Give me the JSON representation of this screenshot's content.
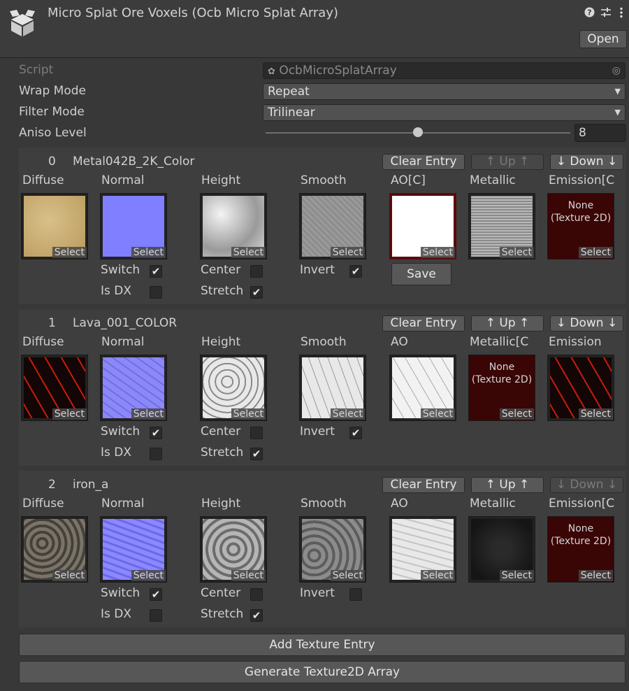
{
  "header": {
    "title": "Micro Splat Ore Voxels (Ocb Micro Splat Array)",
    "open_label": "Open",
    "help_icon": "help-icon",
    "settings_icon": "sliders-icon",
    "menu_icon": "kebab-menu-icon"
  },
  "properties": {
    "script_label": "Script",
    "script_value": "OcbMicroSplatArray",
    "wrap_label": "Wrap Mode",
    "wrap_value": "Repeat",
    "filter_label": "Filter Mode",
    "filter_value": "Trilinear",
    "aniso_label": "Aniso Level",
    "aniso_value": "8",
    "aniso_level": 8
  },
  "entries": [
    {
      "index": "0",
      "name": "Metal042B_2K_Color",
      "clear_label": "Clear Entry",
      "up_label": "↑ Up ↑",
      "down_label": "↓ Down ↓",
      "up_enabled": false,
      "down_enabled": true,
      "slots": {
        "diffuse": "Diffuse",
        "normal": "Normal",
        "height": "Height",
        "smooth": "Smooth",
        "ao": "AO[C]",
        "metallic": "Metallic",
        "emission": "Emission[C"
      },
      "select": "Select",
      "emission_none": "None\n(Texture 2D)",
      "switch_label": "Switch",
      "isdx_label": "Is DX",
      "center_label": "Center",
      "stretch_label": "Stretch",
      "invert_label": "Invert",
      "switch": true,
      "isdx": false,
      "center": false,
      "stretch": true,
      "invert": true,
      "save_label": "Save"
    },
    {
      "index": "1",
      "name": "Lava_001_COLOR",
      "clear_label": "Clear Entry",
      "up_label": "↑ Up ↑",
      "down_label": "↓ Down ↓",
      "up_enabled": true,
      "down_enabled": true,
      "slots": {
        "diffuse": "Diffuse",
        "normal": "Normal",
        "height": "Height",
        "smooth": "Smooth",
        "ao": "AO",
        "metallic": "Metallic[C",
        "emission": "Emission"
      },
      "select": "Select",
      "metallic_none": "None\n(Texture 2D)",
      "switch_label": "Switch",
      "isdx_label": "Is DX",
      "center_label": "Center",
      "stretch_label": "Stretch",
      "invert_label": "Invert",
      "switch": true,
      "isdx": false,
      "center": false,
      "stretch": true,
      "invert": true
    },
    {
      "index": "2",
      "name": "iron_a",
      "clear_label": "Clear Entry",
      "up_label": "↑ Up ↑",
      "down_label": "↓ Down ↓",
      "up_enabled": true,
      "down_enabled": false,
      "slots": {
        "diffuse": "Diffuse",
        "normal": "Normal",
        "height": "Height",
        "smooth": "Smooth",
        "ao": "AO",
        "metallic": "Metallic",
        "emission": "Emission[C"
      },
      "select": "Select",
      "emission_none": "None\n(Texture 2D)",
      "switch_label": "Switch",
      "isdx_label": "Is DX",
      "center_label": "Center",
      "stretch_label": "Stretch",
      "invert_label": "Invert",
      "switch": true,
      "isdx": false,
      "center": false,
      "stretch": true,
      "invert": false
    }
  ],
  "actions": {
    "add_label": "Add Texture Entry",
    "generate_label": "Generate Texture2D Array"
  },
  "colors": {
    "background": "#383838",
    "entry_bg": "#3e3e3e",
    "button": "#585858",
    "missing_texture": "#3a0505"
  }
}
